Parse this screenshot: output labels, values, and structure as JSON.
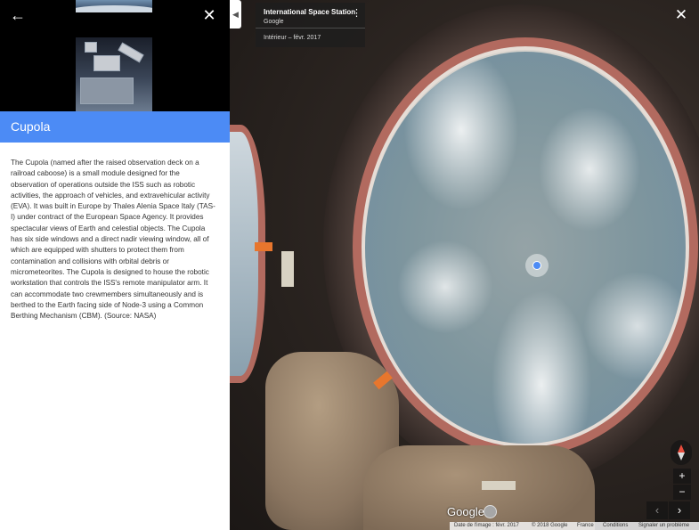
{
  "left_panel": {
    "back_icon": "arrow-left-icon",
    "close_icon": "close-icon",
    "title": "Cupola",
    "description": "The Cupola (named after the raised observation deck on a railroad caboose) is a small module designed for the observation of operations outside the ISS such as robotic activities, the approach of vehicles, and extravehicular activity (EVA). It was built in Europe by Thales Alenia Space Italy (TAS-I) under contract of the European Space Agency. It provides spectacular views of Earth and celestial objects. The Cupola has six side windows and a direct nadir viewing window, all of which are equipped with shutters to protect them from contamination and collisions with orbital debris or micrometeorites. The Cupola is designed to house the robotic workstation that controls the ISS's remote manipulator arm. It can accommodate two crewmembers simultaneously and is berthed to the Earth facing side of Node-3 using a Common Berthing Mechanism (CBM). (Source: NASA)",
    "accent_color": "#4c8bf5"
  },
  "info_card": {
    "title": "International Space Station",
    "subtitle": "Google",
    "date": "Intérieur – févr. 2017",
    "more_icon": "more-vert-icon"
  },
  "panorama": {
    "collapse_icon": "chevron-left-icon",
    "close_icon": "close-icon",
    "location_dot": "location-dot-icon"
  },
  "controls": {
    "compass_icon": "compass-icon",
    "zoom_in": "+",
    "zoom_out": "−",
    "prev_icon": "chevron-left-icon",
    "next_icon": "chevron-right-icon",
    "logo": "Google",
    "pegman_icon": "pegman-icon"
  },
  "footer": {
    "image_date": "Date de l'image : févr. 2017",
    "copyright": "© 2018 Google",
    "country": "France",
    "terms": "Conditions",
    "report": "Signaler un problème"
  }
}
